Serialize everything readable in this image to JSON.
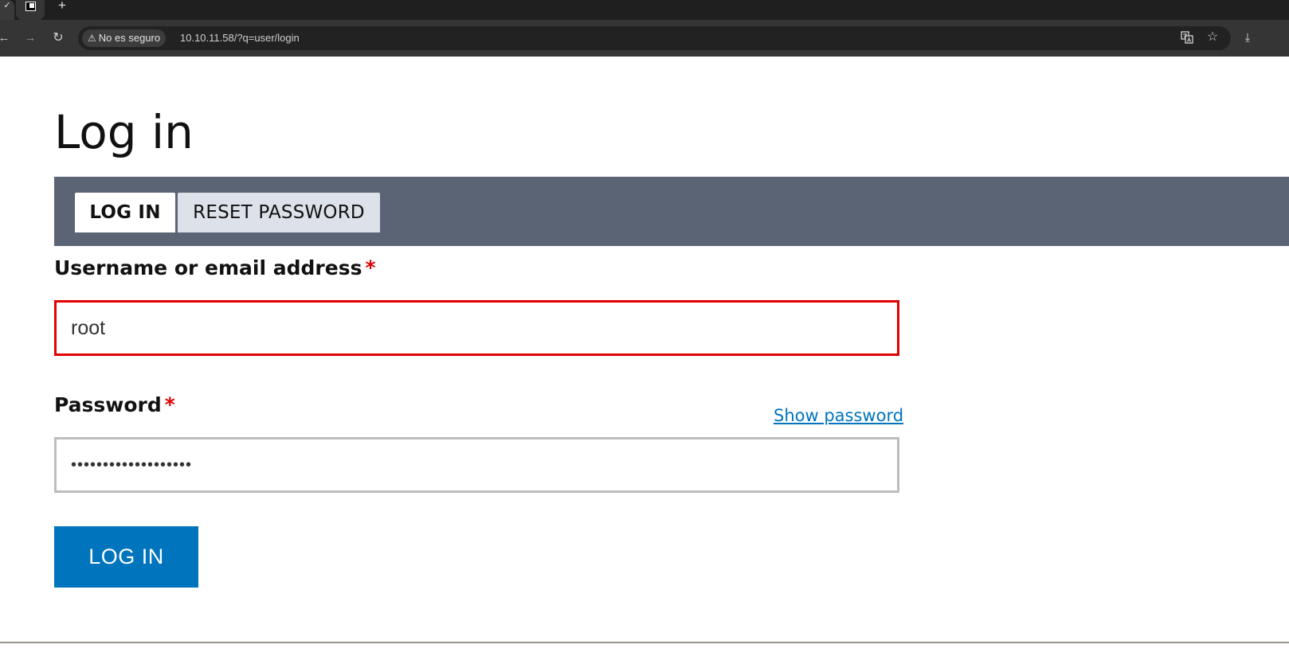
{
  "browser": {
    "tab_left_stub_glyph": "✓",
    "new_tab_glyph": "+",
    "security_label": "No es seguro",
    "url": "10.10.11.58/?q=user/login",
    "icons": [
      "back-icon",
      "forward-icon",
      "reload-icon",
      "warning-icon",
      "translate-icon",
      "bookmark-star-icon",
      "download-icon"
    ]
  },
  "page": {
    "title": "Log in",
    "tabs": [
      {
        "label": "LOG IN",
        "active": true
      },
      {
        "label": "RESET PASSWORD",
        "active": false
      }
    ],
    "username": {
      "label": "Username or email address",
      "required_mark": "*",
      "value": "root"
    },
    "password": {
      "label": "Password",
      "required_mark": "*",
      "value": "•••••••••••••••••••",
      "show_password_link": "Show password"
    },
    "submit_label": "LOG IN"
  },
  "colors": {
    "tabs_bar": "#5b6475",
    "inactive_tab": "#dde1ea",
    "error_border": "#e20000",
    "required": "#e00000",
    "primary_button": "#0074bd",
    "link": "#0074bd"
  }
}
